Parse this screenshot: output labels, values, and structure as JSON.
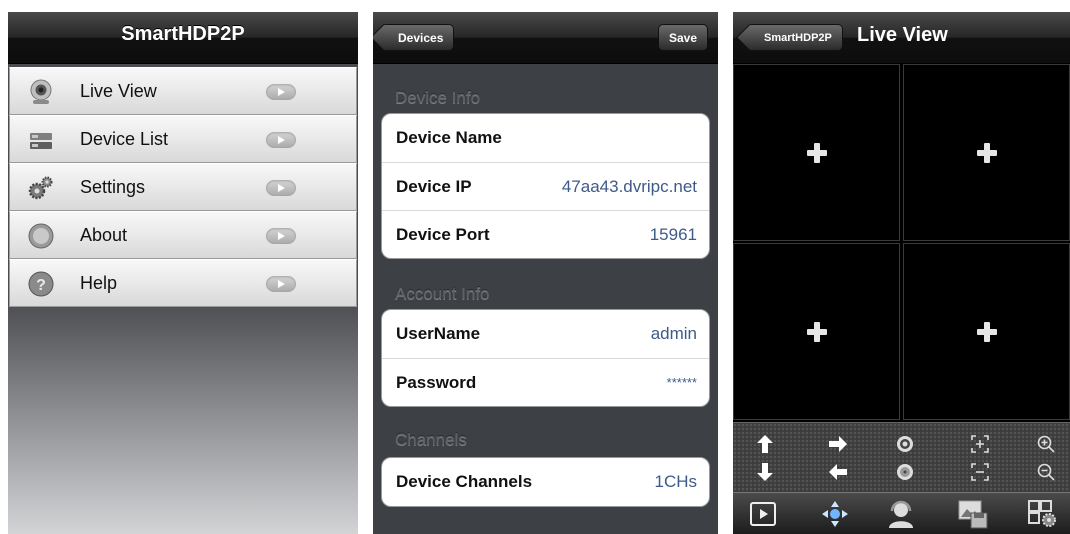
{
  "screen1": {
    "title": "SmartHDP2P",
    "menu": [
      {
        "label": "Live View",
        "icon": "webcam-icon"
      },
      {
        "label": "Device List",
        "icon": "device-list-icon"
      },
      {
        "label": "Settings",
        "icon": "gears-icon"
      },
      {
        "label": "About",
        "icon": "about-icon"
      },
      {
        "label": "Help",
        "icon": "help-icon"
      }
    ]
  },
  "screen2": {
    "back_label": "Devices",
    "save_label": "Save",
    "device_info": {
      "title": "Device Info",
      "rows": [
        {
          "label": "Device Name",
          "value": ""
        },
        {
          "label": "Device IP",
          "value": "47aa43.dvripc.net"
        },
        {
          "label": "Device Port",
          "value": "15961"
        }
      ]
    },
    "account_info": {
      "title": "Account Info",
      "rows": [
        {
          "label": "UserName",
          "value": "admin"
        },
        {
          "label": "Password",
          "value": "******"
        }
      ]
    },
    "channels": {
      "title": "Channels",
      "rows": [
        {
          "label": "Device Channels",
          "value": "1CHs"
        }
      ]
    }
  },
  "screen3": {
    "back_label": "SmartHDP2P",
    "title": "Live View",
    "ptz_controls": [
      "up-arrow-icon",
      "right-arrow-icon",
      "iris-open-icon",
      "focus-in-icon",
      "zoom-in-icon",
      "down-arrow-icon",
      "left-arrow-icon",
      "iris-close-icon",
      "focus-out-icon",
      "zoom-out-icon"
    ],
    "tabs": [
      "play-icon",
      "ptz-move-icon",
      "operator-icon",
      "snapshot-save-icon",
      "layout-settings-icon"
    ]
  },
  "colors": {
    "value_blue": "#3e5a88",
    "navbar_dark": "#111111",
    "section_text": "#5d6166"
  }
}
